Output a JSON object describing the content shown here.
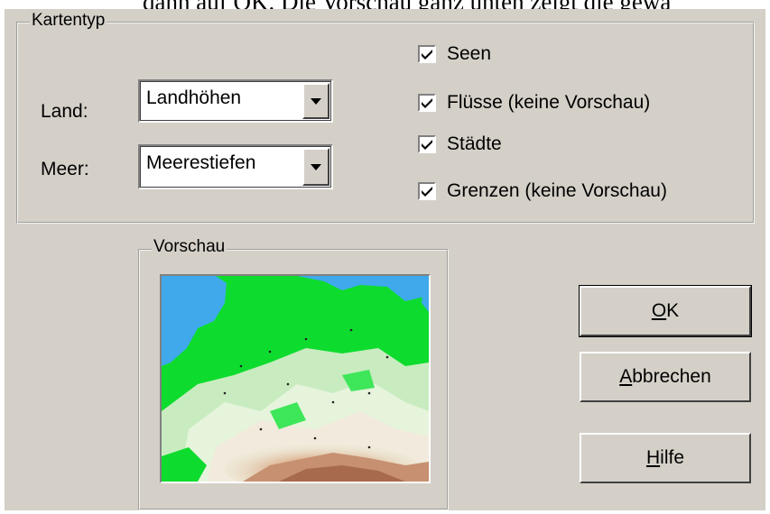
{
  "top_caption": "dann auf OK. Die Vorschau ganz unten zeigt die gewä",
  "kartentyp": {
    "title": "Kartentyp",
    "land_label": "Land:",
    "land_value": "Landhöhen",
    "meer_label": "Meer:",
    "meer_value": "Meerestiefen",
    "checkboxes": [
      {
        "label": "Seen",
        "checked": true
      },
      {
        "label": "Flüsse (keine Vorschau)",
        "checked": true
      },
      {
        "label": "Städte",
        "checked": true
      },
      {
        "label": "Grenzen (keine Vorschau)",
        "checked": true
      }
    ]
  },
  "vorschau": {
    "title": "Vorschau",
    "colors": {
      "sea": "#44aaee",
      "lowland": "#0ddc2e",
      "hills": "#d8f0d0",
      "mountains": "#c99070"
    }
  },
  "buttons": {
    "ok": {
      "mnemonic": "O",
      "rest": "K"
    },
    "cancel": {
      "mnemonic": "A",
      "rest": "bbrechen"
    },
    "help": {
      "mnemonic": "H",
      "rest": "ilfe"
    }
  },
  "icons": {
    "dropdown": "chevron-down-icon",
    "check": "check-icon"
  }
}
